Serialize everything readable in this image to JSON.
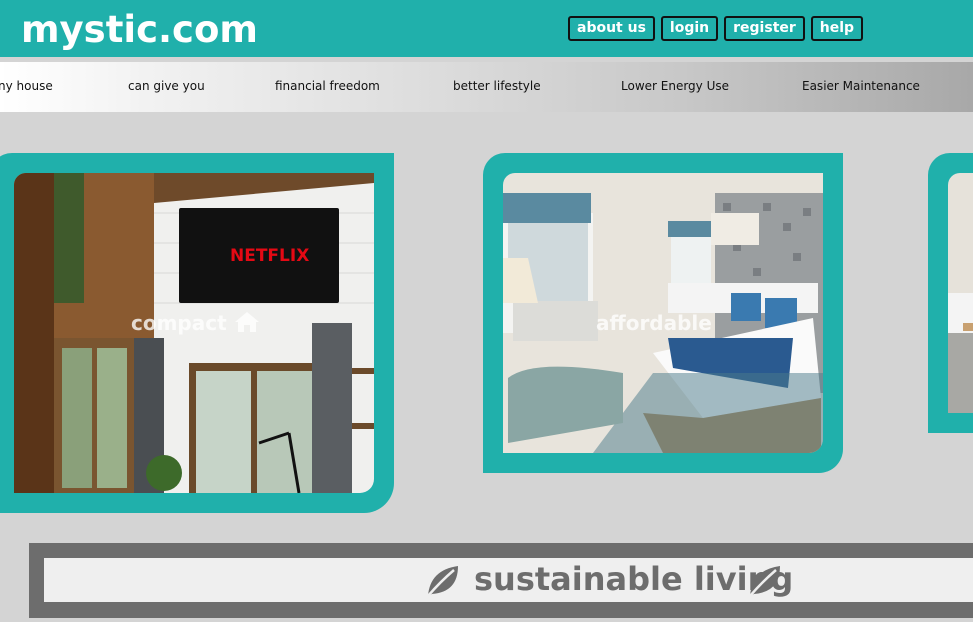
{
  "header": {
    "logo": "mystic.com",
    "nav": [
      "about us",
      "login",
      "register",
      "help"
    ]
  },
  "ticker": [
    "ny house",
    "can give you",
    "financial freedom",
    "better lifestyle",
    "Lower Energy Use",
    "Easier Maintenance"
  ],
  "cards": [
    {
      "label": "compact",
      "icon": "home-icon"
    },
    {
      "label": "affordable",
      "icon": "home-icon"
    },
    {
      "label": "",
      "icon": ""
    }
  ],
  "banner": {
    "text": "sustainable living",
    "icon": "leaf-icon"
  },
  "colors": {
    "accent": "#20b0ab",
    "banner": "#6d6d6d",
    "background": "#d4d4d4"
  }
}
